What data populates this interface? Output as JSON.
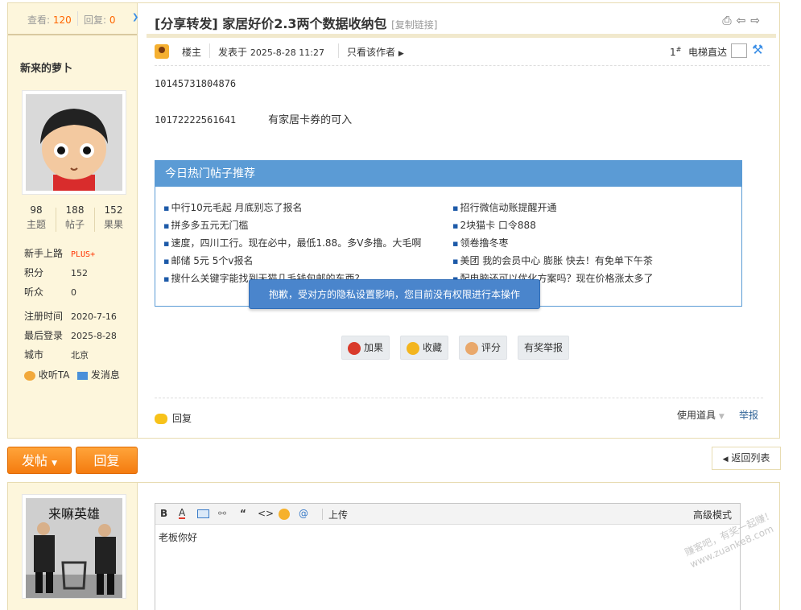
{
  "stats_bar": {
    "views_label": "查看:",
    "views": "120",
    "replies_label": "回复:",
    "replies": "0"
  },
  "author": {
    "name": "新来的萝卜",
    "counts": [
      {
        "value": "98",
        "label": "主题"
      },
      {
        "value": "188",
        "label": "帖子"
      },
      {
        "value": "152",
        "label": "果果"
      }
    ],
    "rank_label": "新手上路",
    "rank_badge": "PLUS+",
    "points_label": "积分",
    "points": "152",
    "listeners_label": "听众",
    "listeners": "0",
    "reg_label": "注册时间",
    "reg_date": "2020-7-16",
    "login_label": "最后登录",
    "login_date": "2025-8-28",
    "city_label": "城市",
    "city": "北京",
    "follow_label": "收听TA",
    "message_label": "发消息"
  },
  "thread": {
    "title": "[分享转发] 家居好价2.3两个数据收纳包",
    "copy_link": "[复制链接]"
  },
  "post_meta": {
    "role": "楼主",
    "posted_prefix": "发表于",
    "posted_time": "2025-8-28 11:27",
    "only_author": "只看该作者",
    "floor_no": "1",
    "floor_sup": "#",
    "elevator": "电梯直达"
  },
  "post_body": {
    "line1": "10145731804876",
    "line2_code": "10172222561641",
    "line2_note": "有家居卡券的可入"
  },
  "recommend": {
    "header": "今日热门帖子推荐",
    "left": [
      "中行10元毛起 月底别忘了报名",
      "拼多多五元无门槛",
      "速度，四川工行。现在必中，最低1.88。多V多撸。大毛啊",
      "邮储 5元 5个v报名",
      "搜什么关键字能找到天猫几毛钱包邮的东西?"
    ],
    "right": [
      "招行微信动账提醒开通",
      "2块猫卡 口令888",
      "领卷撸冬枣",
      "美团 我的会员中心 膨胀 快去！有免单下午茶",
      "配电脑还可以优化方案吗？现在价格涨太多了"
    ]
  },
  "tooltip": "抱歉，受对方的隐私设置影响，您目前没有权限进行本操作",
  "post_actions": {
    "add": "加果",
    "favorite": "收藏",
    "rate": "评分",
    "report_reward": "有奖举报"
  },
  "post_footer": {
    "reply": "回复",
    "use_tool": "使用道具",
    "report": "举报"
  },
  "actions": {
    "new_post": "发帖",
    "reply": "回复",
    "back_list": "返回列表"
  },
  "reply_panel": {
    "avatar_caption": "来嘛英雄",
    "editor_text": "老板你好",
    "upload": "上传",
    "advanced": "高级模式"
  },
  "watermark": {
    "line1": "赚客吧，有奖一起赚！",
    "line2": "www.zuanke8.com"
  }
}
